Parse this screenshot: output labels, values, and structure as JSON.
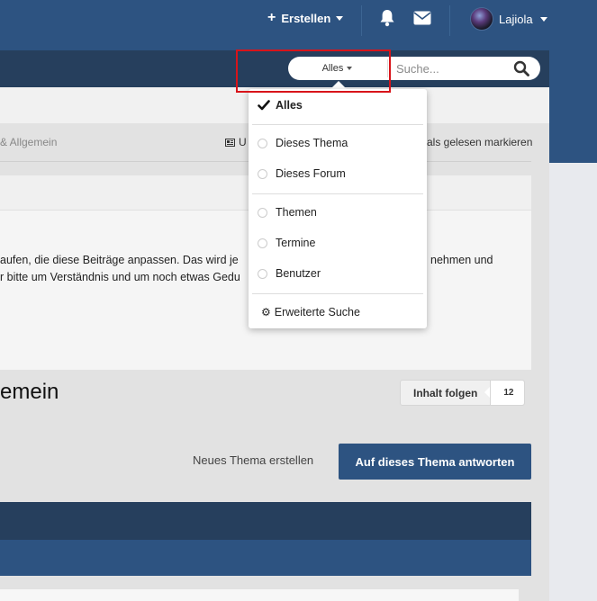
{
  "header": {
    "create_label": "Erstellen",
    "user_name": "Lajiola",
    "icons": [
      "plus-icon",
      "bell-icon",
      "envelope-icon",
      "caret-down-icon"
    ]
  },
  "search": {
    "type_label": "Alles",
    "placeholder": "Suche...",
    "icon": "search-icon"
  },
  "search_menu": {
    "items": [
      {
        "label": "Alles",
        "selected": true
      },
      {
        "label": "Dieses Thema",
        "selected": false
      },
      {
        "label": "Dieses Forum",
        "selected": false
      },
      {
        "label": "Themen",
        "selected": false
      },
      {
        "label": "Termine",
        "selected": false
      },
      {
        "label": "Benutzer",
        "selected": false
      }
    ],
    "advanced_label": "Erweiterte Suche"
  },
  "breadcrumb": {
    "text": "& Allgemein",
    "unread_label": "U",
    "mark_read_label": "als gelesen markieren"
  },
  "notice": {
    "line1": "aufen, die diese Beiträge anpassen. Das wird je",
    "line1_end": "nehmen und",
    "line2": "r bitte um Verständnis und um noch etwas Gedu"
  },
  "forum": {
    "title": "emein",
    "follow_label": "Inhalt folgen",
    "follow_count": "12",
    "new_topic_label": "Neues Thema erstellen",
    "reply_label": "Auf dieses Thema antworten"
  },
  "colors": {
    "header_blue": "#2d5381",
    "nav_dark": "#263f5d",
    "highlight_red": "#d8141a"
  }
}
